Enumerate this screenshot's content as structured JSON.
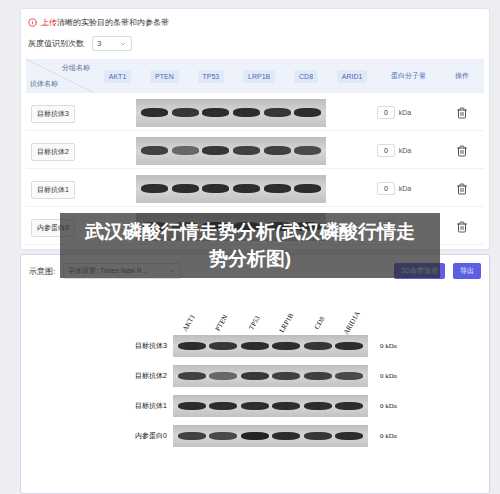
{
  "header": {
    "highlight": "上传",
    "text": "清晰的实验目的条带和内参条带"
  },
  "repeat": {
    "label": "灰度值识别次数",
    "value": "3"
  },
  "table": {
    "corner_top": "分组名称",
    "corner_bottom": "抗体名称",
    "lanes": [
      "AKT1",
      "PTEN",
      "TP53",
      "LRP1B",
      "CD8",
      "ARID1"
    ],
    "mass_header": "蛋白分子量",
    "action_header": "操作",
    "rows": [
      {
        "name": "目标抗体3",
        "mass": "0",
        "unit": "kDa",
        "bands": [
          0.85,
          0.8,
          0.85,
          0.85,
          0.8,
          0.85
        ]
      },
      {
        "name": "目标抗体2",
        "mass": "0",
        "unit": "kDa",
        "bands": [
          0.75,
          0.55,
          0.8,
          0.75,
          0.75,
          0.7
        ]
      },
      {
        "name": "目标抗体1",
        "mass": "0",
        "unit": "kDa",
        "bands": [
          0.85,
          0.85,
          0.85,
          0.85,
          0.85,
          0.85
        ]
      },
      {
        "name": "内参蛋白0",
        "mass": "0",
        "unit": "kDa",
        "bands": [
          0.75,
          0.7,
          0.9,
          0.85,
          0.8,
          0.85
        ]
      }
    ]
  },
  "watermark": "武汉磷酸行情走势分析(武汉磷酸行情走势分析图)",
  "preview": {
    "title": "示意图:",
    "font_select": "字体设置: Times New R...",
    "buttons": [
      "3D条带预览",
      "导出"
    ],
    "lanes": [
      "AKT1",
      "PTEN",
      "TP53",
      "LRP1B",
      "CD8",
      "ARID1A"
    ],
    "rows": [
      {
        "name": "目标抗体3",
        "mass": "0 kDa",
        "bands": [
          0.85,
          0.8,
          0.85,
          0.85,
          0.8,
          0.85
        ]
      },
      {
        "name": "目标抗体2",
        "mass": "0 kDa",
        "bands": [
          0.75,
          0.55,
          0.8,
          0.75,
          0.75,
          0.7
        ]
      },
      {
        "name": "目标抗体1",
        "mass": "0 kDa",
        "bands": [
          0.85,
          0.85,
          0.85,
          0.85,
          0.85,
          0.85
        ]
      },
      {
        "name": "内参蛋白0",
        "mass": "0 kDa",
        "bands": [
          0.75,
          0.7,
          0.9,
          0.85,
          0.8,
          0.85
        ]
      }
    ]
  }
}
